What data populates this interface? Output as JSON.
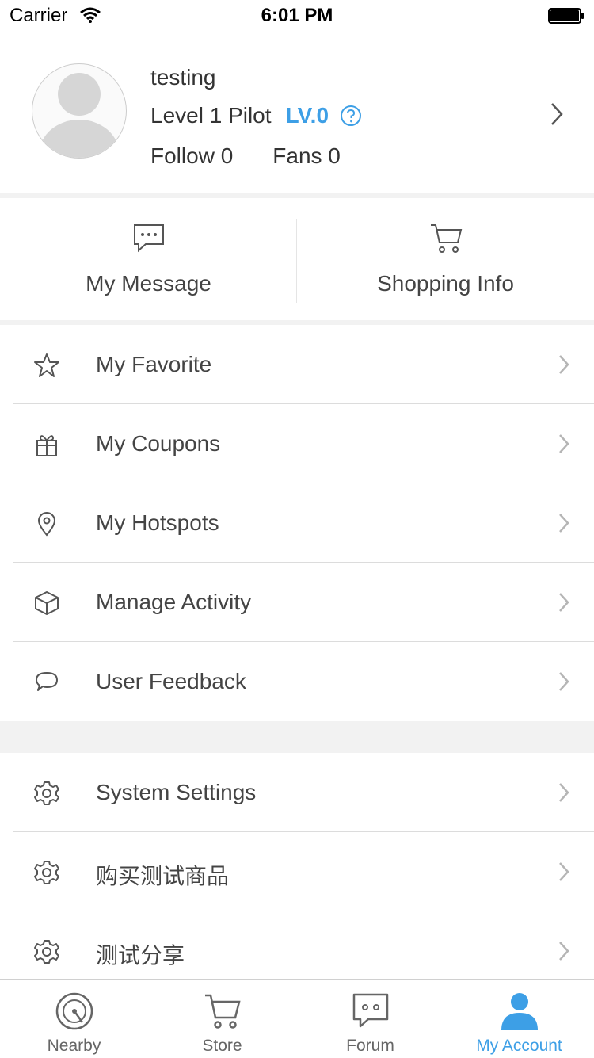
{
  "status_bar": {
    "carrier": "Carrier",
    "time": "6:01 PM"
  },
  "profile": {
    "username": "testing",
    "level_title": "Level 1 Pilot",
    "level_badge": "LV.0",
    "follow": "Follow 0",
    "fans": "Fans 0"
  },
  "quick_actions": [
    {
      "label": "My Message",
      "icon": "message-icon"
    },
    {
      "label": "Shopping Info",
      "icon": "cart-icon"
    }
  ],
  "menu_group_1": [
    {
      "label": "My Favorite",
      "icon": "star-icon"
    },
    {
      "label": "My Coupons",
      "icon": "gift-icon"
    },
    {
      "label": "My Hotspots",
      "icon": "location-pin-icon"
    },
    {
      "label": "Manage Activity",
      "icon": "cube-icon"
    },
    {
      "label": "User Feedback",
      "icon": "speech-bubble-icon"
    }
  ],
  "menu_group_2": [
    {
      "label": "System Settings",
      "icon": "gear-icon"
    },
    {
      "label": "购买测试商品",
      "icon": "gear-icon"
    },
    {
      "label": "测试分享",
      "icon": "gear-icon"
    }
  ],
  "tabbar": {
    "tabs": [
      {
        "label": "Nearby",
        "icon": "radar-icon"
      },
      {
        "label": "Store",
        "icon": "cart-icon"
      },
      {
        "label": "Forum",
        "icon": "chat-icon"
      },
      {
        "label": "My Account",
        "icon": "person-icon"
      }
    ],
    "active": "My Account"
  },
  "colors": {
    "accent": "#3d9fe6",
    "divider": "#dcdcdc",
    "section_gap": "#f2f2f2"
  }
}
